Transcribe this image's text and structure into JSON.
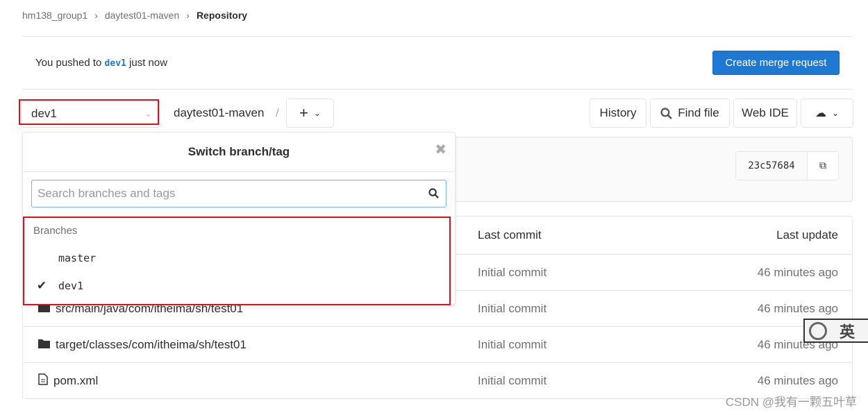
{
  "breadcrumb": [
    "hm138_group1",
    "daytest01-maven",
    "Repository"
  ],
  "push_notice": {
    "prefix": "You pushed to",
    "branch": "dev1",
    "suffix": "just now",
    "button": "Create merge request"
  },
  "toolbar": {
    "branch": "dev1",
    "path": "daytest01-maven",
    "separator": "/",
    "history": "History",
    "find_file": "Find file",
    "web_ide": "Web IDE"
  },
  "commit": {
    "sha": "23c57684"
  },
  "table": {
    "headers": {
      "last_commit": "Last commit",
      "last_update": "Last update"
    },
    "rows": [
      {
        "name": "",
        "icon": "folder-icon",
        "commit": "Initial commit",
        "updated": "46 minutes ago"
      },
      {
        "name": "src/main/java/com/itheima/sh/test01",
        "icon": "folder-icon",
        "commit": "Initial commit",
        "updated": "46 minutes ago"
      },
      {
        "name": "target/classes/com/itheima/sh/test01",
        "icon": "folder-icon",
        "commit": "Initial commit",
        "updated": "46 minutes ago"
      },
      {
        "name": "pom.xml",
        "icon": "file-icon",
        "commit": "Initial commit",
        "updated": "46 minutes ago"
      }
    ]
  },
  "dropdown": {
    "title": "Switch branch/tag",
    "placeholder": "Search branches and tags",
    "section": "Branches",
    "branches": [
      {
        "name": "master",
        "selected": false
      },
      {
        "name": "dev1",
        "selected": true
      }
    ]
  },
  "ime": {
    "label": "英"
  },
  "watermark": "CSDN @我有一颗五叶草",
  "colors": {
    "accent": "#1f78d1",
    "highlight": "#e2101e"
  }
}
